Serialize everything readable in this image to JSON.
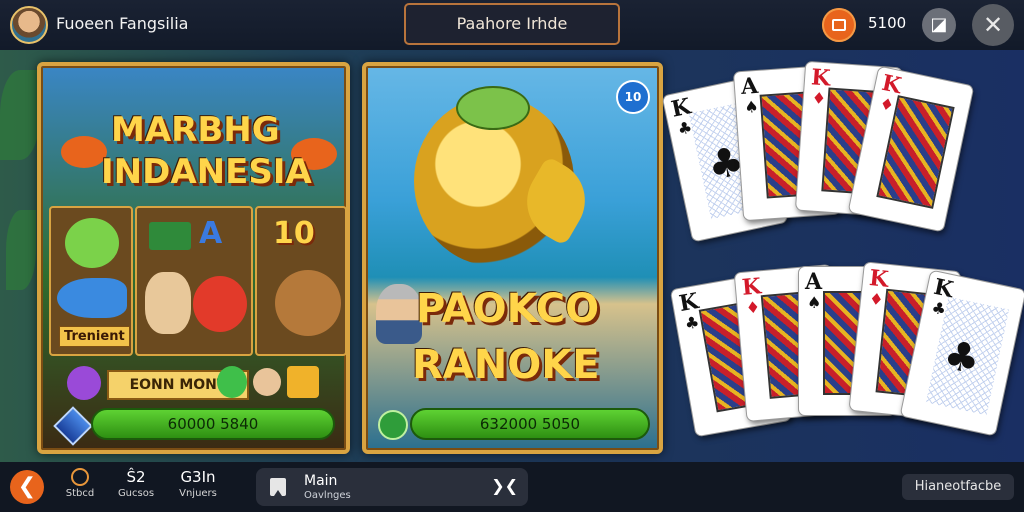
{
  "header": {
    "title": "Fuoeen Fangsilia",
    "search_text": "Paahore Irhde",
    "coin_count": "5100",
    "shop_glyph": "◪",
    "close_glyph": "✕"
  },
  "game_left": {
    "title_line1": "MARBHG",
    "title_line2": "INDANESIA",
    "tile_a_text": "A",
    "tile_10_text": "10",
    "tile_label": "Trenient",
    "bonus_label": "EONN MONT",
    "score": "60000 5840"
  },
  "game_right": {
    "badge": "10",
    "title_line1": "PAOKCO",
    "title_line2": "RANOKE",
    "score": "632000 5050"
  },
  "cards_top": [
    {
      "rank": "K",
      "suit": "♣",
      "color": "black",
      "type": "pip"
    },
    {
      "rank": "A",
      "suit": "♠",
      "color": "black",
      "type": "face"
    },
    {
      "rank": "K",
      "suit": "♦",
      "color": "red",
      "type": "face"
    },
    {
      "rank": "K",
      "suit": "♦",
      "color": "red",
      "type": "face"
    }
  ],
  "cards_bottom": [
    {
      "rank": "K",
      "suit": "♣",
      "color": "black",
      "type": "face"
    },
    {
      "rank": "K",
      "suit": "♦",
      "color": "red",
      "type": "face"
    },
    {
      "rank": "A",
      "suit": "♠",
      "color": "black",
      "type": "face"
    },
    {
      "rank": "K",
      "suit": "♦",
      "color": "red",
      "type": "face"
    },
    {
      "rank": "K",
      "suit": "♣",
      "color": "black",
      "type": "pip"
    }
  ],
  "bottom_nav": {
    "back_glyph": "❮",
    "items": [
      {
        "glyph": "",
        "label": "Stbcd"
      },
      {
        "glyph": "Ŝ2",
        "label": "Gucsos"
      },
      {
        "glyph": "G3In",
        "label": "Vnjuers"
      }
    ],
    "main_title": "Main",
    "main_sub": "Oavlnges",
    "main_arrows": "❯❮",
    "right_button": "Hianeotfacbe"
  },
  "colors": {
    "accent": "#e8641c",
    "gold_border": "#d9a441",
    "score_green": "#5ed233"
  }
}
